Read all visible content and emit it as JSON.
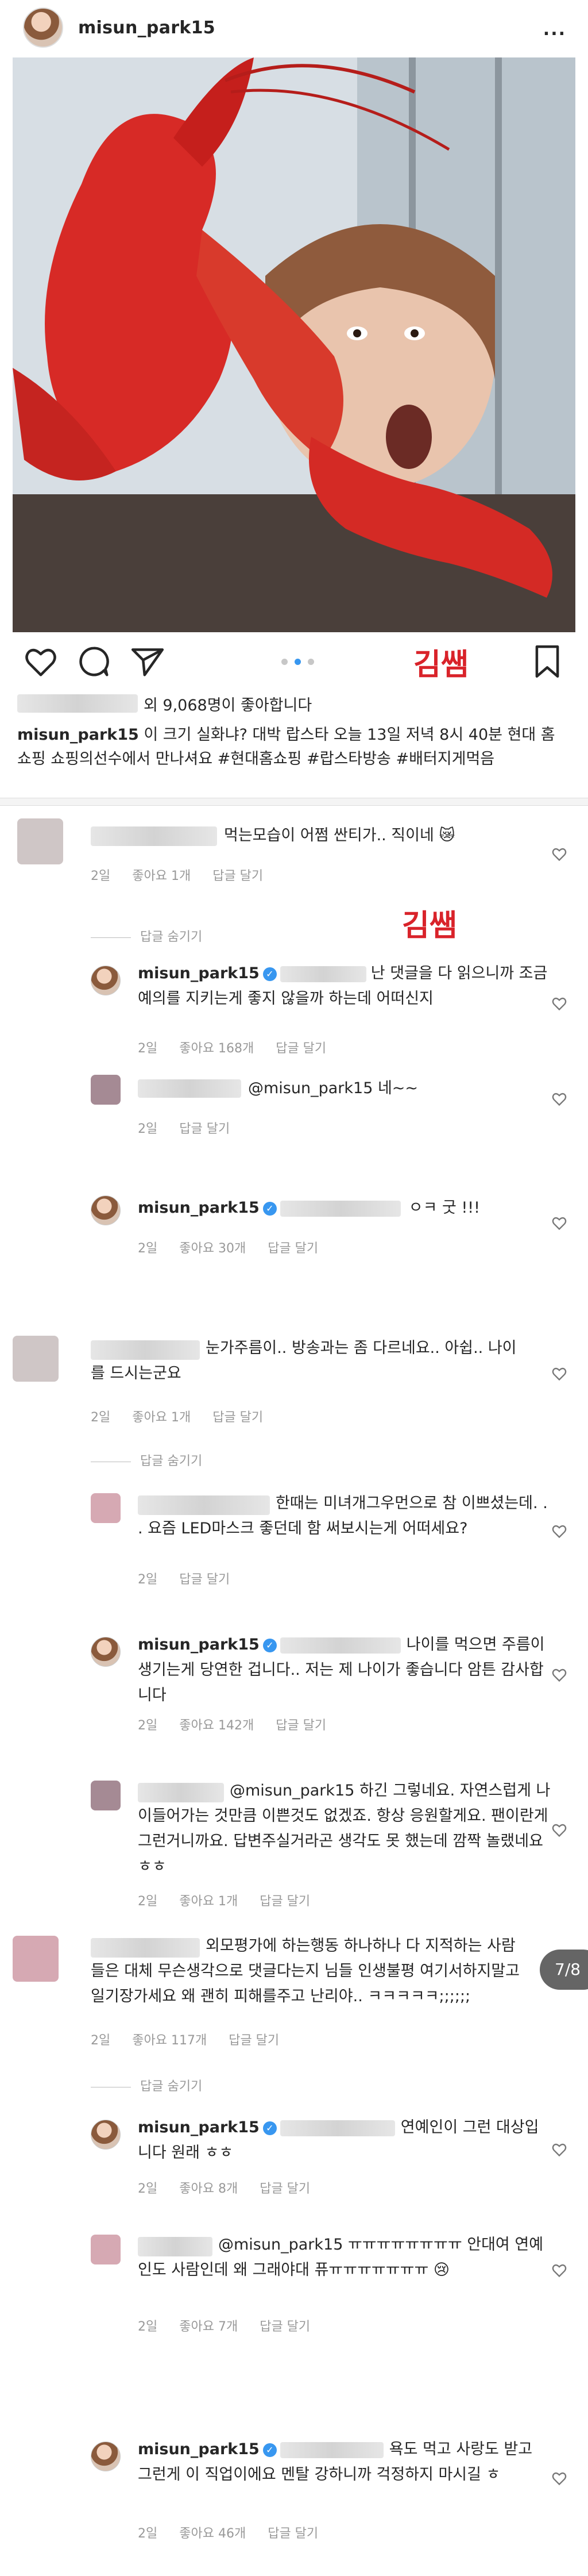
{
  "header": {
    "username": "misun_park15",
    "more": "..."
  },
  "red_label": "김쌤",
  "likes": {
    "text": "외 9,068명이 좋아합니다"
  },
  "caption": {
    "username": "misun_park15",
    "text": " 이 크기 실화냐? 대박 랍스타 오늘 13일 저녁 8시 40분 현대 홈쇼핑 쇼핑의선수에서 만나셔요 #현대홈쇼핑 #랍스타방송 #배터지게먹음"
  },
  "colors": {
    "accent": "#3897f0",
    "red_label": "#d9232a",
    "meta": "#999999"
  },
  "comments": [
    {
      "text": "먹는모습이 어쩜 싼티가.. 직이네 😿",
      "age": "2일",
      "likes": "좋아요 1개",
      "reply": "답글 달기"
    },
    {
      "toggle": "답글 숨기기"
    },
    {
      "username": "misun_park15",
      "text": "난 댓글을 다 읽으니까 조금 예의를 지키는게 좋지 않을까 하는데 어떠신지",
      "age": "2일",
      "likes": "좋아요 168개",
      "reply": "답글 달기"
    },
    {
      "text": "@misun_park15 네~~",
      "age": "2일",
      "reply": "답글 달기"
    },
    {
      "username": "misun_park15",
      "text": "ㅇㅋ 굿 !!!",
      "age": "2일",
      "likes": "좋아요 30개",
      "reply": "답글 달기"
    },
    {
      "text": "눈가주름이.. 방송과는 좀 다르네요.. 아쉽.. 나이를 드시는군요",
      "age": "2일",
      "likes": "좋아요 1개",
      "reply": "답글 달기"
    },
    {
      "toggle": "답글 숨기기"
    },
    {
      "text": "한때는 미녀개그우먼으로 참 이쁘셨는데. . . 요즘 LED마스크 좋던데 함 써보시는게 어떠세요?",
      "age": "2일",
      "reply": "답글 달기"
    },
    {
      "username": "misun_park15",
      "text": "나이를 먹으면 주름이 생기는게 당연한 겁니다.. 저는 제 나이가 좋습니다 암튼 감사합니다",
      "age": "2일",
      "likes": "좋아요 142개",
      "reply": "답글 달기"
    },
    {
      "text": "@misun_park15 하긴 그렇네요. 자연스럽게 나이들어가는 것만큼 이쁜것도 없겠죠. 항상 응원할게요. 팬이란게 그런거니까요. 답변주실거라곤 생각도 못 했는데 깜짝 놀랬네요 ㅎㅎ",
      "age": "2일",
      "likes": "좋아요 1개",
      "reply": "답글 달기"
    },
    {
      "text": "외모평가에 하는행동 하나하나 다 지적하는 사람들은 대체 무슨생각으로 댓글다는지 님들 인생불평 여기서하지말고 일기장가세요 왜 괜히 피해를주고 난리야.. ㅋㅋㅋㅋㅋ;;;;;;",
      "age": "2일",
      "likes": "좋아요 117개",
      "reply": "답글 달기"
    },
    {
      "toggle": "답글 숨기기"
    },
    {
      "username": "misun_park15",
      "text": "연예인이 그런 대상입니다 원래 ㅎㅎ",
      "age": "2일",
      "likes": "좋아요 8개",
      "reply": "답글 달기"
    },
    {
      "text": "@misun_park15 ㅠㅠㅠㅠㅠㅠㅠㅠ 안대여 연예인도 사람인데 왜 그래야대 퓨ㅠㅠㅠㅠㅠㅠㅠ 😢",
      "age": "2일",
      "likes": "좋아요 7개",
      "reply": "답글 달기"
    },
    {
      "username": "misun_park15",
      "text": "욕도 먹고 사랑도 받고 그런게 이 직업이에요 멘탈 강하니까 걱정하지 마시길 ㅎ",
      "age": "2일",
      "likes": "좋아요 46개",
      "reply": "답글 달기"
    }
  ],
  "page_badge": "7/8"
}
